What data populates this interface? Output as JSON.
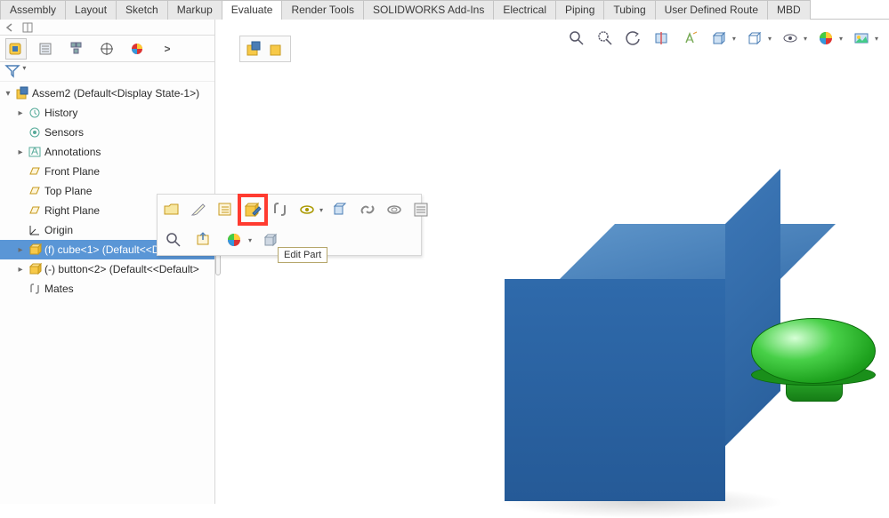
{
  "tabs": {
    "items": [
      {
        "label": "Assembly"
      },
      {
        "label": "Layout"
      },
      {
        "label": "Sketch"
      },
      {
        "label": "Markup"
      },
      {
        "label": "Evaluate"
      },
      {
        "label": "Render Tools"
      },
      {
        "label": "SOLIDWORKS Add-Ins"
      },
      {
        "label": "Electrical"
      },
      {
        "label": "Piping"
      },
      {
        "label": "Tubing"
      },
      {
        "label": "User Defined Route"
      },
      {
        "label": "MBD"
      }
    ],
    "active_index": 4
  },
  "tree": {
    "root": {
      "label": "Assem2  (Default<Display State-1>)"
    },
    "items": [
      {
        "label": "History",
        "icon": "history"
      },
      {
        "label": "Sensors",
        "icon": "sensor"
      },
      {
        "label": "Annotations",
        "icon": "annotation",
        "expandable": true
      },
      {
        "label": "Front Plane",
        "icon": "plane"
      },
      {
        "label": "Top Plane",
        "icon": "plane"
      },
      {
        "label": "Right Plane",
        "icon": "plane"
      },
      {
        "label": "Origin",
        "icon": "origin"
      },
      {
        "label": "(f) cube<1> (Default<<Default>_",
        "icon": "part",
        "expandable": true,
        "selected": true
      },
      {
        "label": "(-) button<2> (Default<<Default>",
        "icon": "part",
        "expandable": true
      },
      {
        "label": "Mates",
        "icon": "mates"
      }
    ]
  },
  "context_toolbar": {
    "tooltip": "Edit Part"
  }
}
